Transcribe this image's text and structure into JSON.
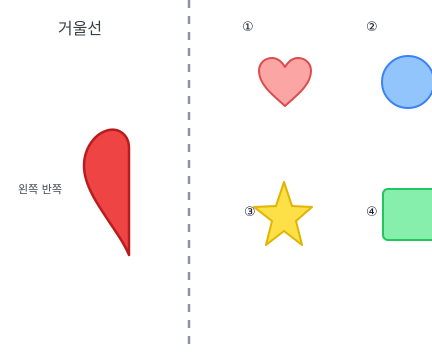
{
  "mirror": {
    "title": "거울선",
    "left_half_label": "왼쪽 반쪽"
  },
  "options": [
    {
      "number": "①",
      "shape": "heart",
      "fill": "#fca5a5",
      "stroke": "#dc4c4c"
    },
    {
      "number": "②",
      "shape": "circle",
      "fill": "#93c5fd",
      "stroke": "#3b82f6"
    },
    {
      "number": "③",
      "shape": "star",
      "fill": "#fde047",
      "stroke": "#e0b400"
    },
    {
      "number": "④",
      "shape": "rectangle",
      "fill": "#86efac",
      "stroke": "#22c55e"
    }
  ],
  "colors": {
    "divider": "#8a93a3",
    "half_shape_fill": "#ef4444",
    "half_shape_stroke": "#b91c1c"
  }
}
